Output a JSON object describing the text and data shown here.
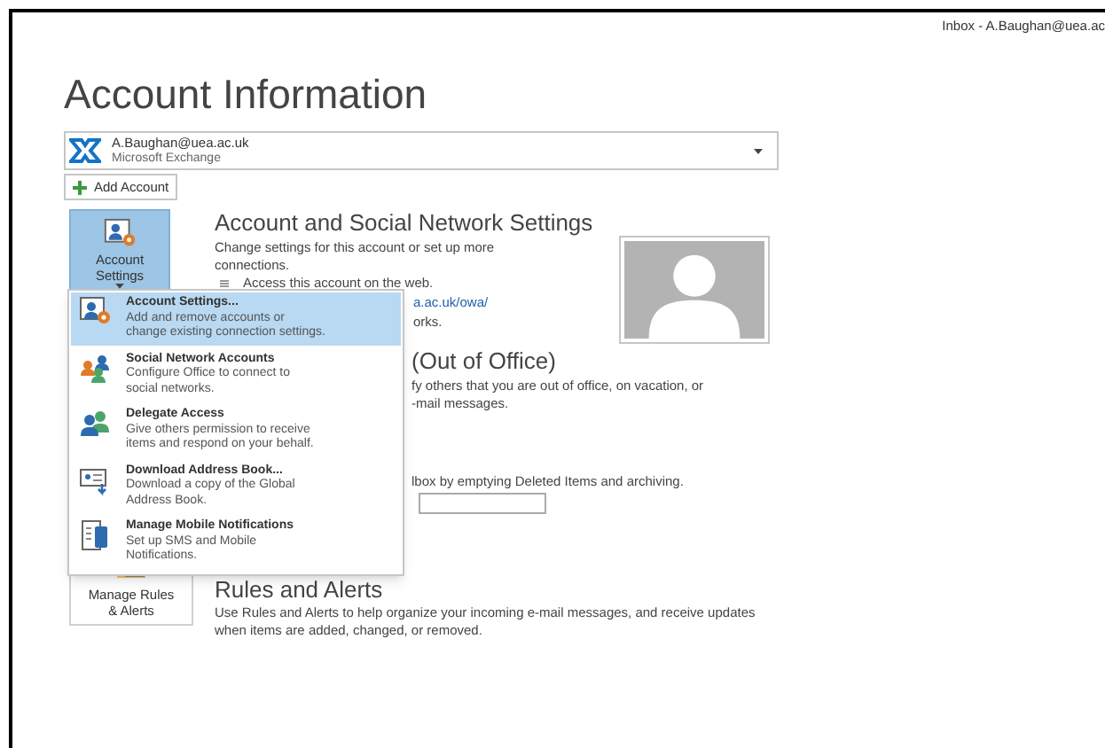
{
  "window": {
    "title": "Inbox - A.Baughan@uea.ac"
  },
  "page_title": "Account Information",
  "account_selector": {
    "email": "A.Baughan@uea.ac.uk",
    "type": "Microsoft Exchange"
  },
  "add_account_button": {
    "label": "Add Account"
  },
  "account_settings_button": {
    "label": "Account Settings",
    "expanded": true
  },
  "account_section": {
    "heading": "Account and Social Network Settings",
    "description": "Change settings for this account or set up more connections.",
    "bullet": "Access this account on the web.",
    "link_fragment": "a.ac.uk/owa/",
    "text_fragment": "orks."
  },
  "automatic_replies": {
    "heading_fragment": "(Out of Office)",
    "lines": [
      "fy others that you are out of office, on vacation, or",
      "-mail messages."
    ]
  },
  "mailbox_cleanup": {
    "text_fragment": "lbox by emptying Deleted Items and archiving."
  },
  "rules_and_alerts": {
    "button_label": "Manage Rules & Alerts",
    "heading": "Rules and Alerts",
    "description": "Use Rules and Alerts to help organize your incoming e-mail messages, and receive updates when items are added, changed, or removed."
  },
  "menu": {
    "items": [
      {
        "kind": "account",
        "title": "Account Settings...",
        "lines": [
          "Add and remove accounts or",
          "change existing connection settings."
        ],
        "selected": true
      },
      {
        "kind": "social",
        "title": "Social Network Accounts",
        "lines": [
          "Configure Office to connect to",
          "social networks."
        ],
        "selected": false
      },
      {
        "kind": "delegate",
        "title": "Delegate Access",
        "lines": [
          "Give others permission to receive",
          "items and respond on your behalf."
        ],
        "selected": false
      },
      {
        "kind": "addressbook",
        "title": "Download Address Book...",
        "lines": [
          "Download a copy of the Global",
          "Address Book."
        ],
        "selected": false
      },
      {
        "kind": "mobile",
        "title": "Manage Mobile Notifications",
        "lines": [
          "Set up SMS and Mobile",
          "Notifications."
        ],
        "selected": false
      }
    ]
  }
}
